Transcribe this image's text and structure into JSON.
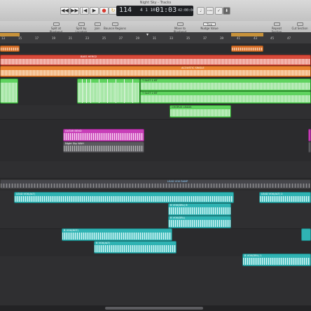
{
  "window": {
    "title": "Night Sky - Tracks"
  },
  "transport": {
    "rewind": "◀◀",
    "forward": "▶▶",
    "to_start": "|◀",
    "play": "▶",
    "record": "●",
    "cycle": "↻",
    "tempo": "114",
    "signature": "4  1  101",
    "time": "01:03",
    "frames": "42:00:04",
    "metronome": "♩",
    "count_in": "1234",
    "tuner": "✓",
    "download": "⬇"
  },
  "toolbar": {
    "split_playhead": "Split at Playhead",
    "split_locators": "Split by Locators",
    "join": "Join",
    "bounce_regions": "Bounce Regions",
    "move_playhead": "Move to Playhead",
    "nudge_value": "Nudge Value",
    "nudge_setting": "Tick",
    "repeat_section": "Repeat Section",
    "cut_section": "Cut Section"
  },
  "ruler": {
    "bars": [
      "13",
      "15",
      "17",
      "19",
      "21",
      "23",
      "25",
      "27",
      "29",
      "31",
      "33",
      "35",
      "37",
      "39",
      "41",
      "43",
      "45",
      "47"
    ]
  },
  "regions": {
    "bass_hero": "BASS HERO2",
    "acoustic_single": "ACOUSTIC SINGLE",
    "gt_sort_1": "T SLOT 1 BT",
    "gt_sort_2": "T SLOT 2 BT",
    "chorus_leads": "CHORUS LEADS",
    "gt_bend": "GUTAR BEND",
    "night_sky": "Night Sky WAH",
    "lead_vox_ramp": "LEAD VOX RAMP",
    "lead_vox_1": "LEAD VOX(ALT)",
    "lead_vox_2": "LEAD VOX(ALT) 2",
    "vox_b": "B VOX(DBL) 8",
    "vox_c": "B VOX(DBL)",
    "vox_d": "B VOX(BGT)",
    "vox_e": "B VOX(ALT)",
    "vox_f": "B VOX(DBL) 1"
  },
  "colors": {
    "accent": "#e8812f",
    "green": "#5fd35f",
    "teal": "#2fb3b3",
    "magenta": "#c83fb8",
    "red": "#d84a3a"
  }
}
